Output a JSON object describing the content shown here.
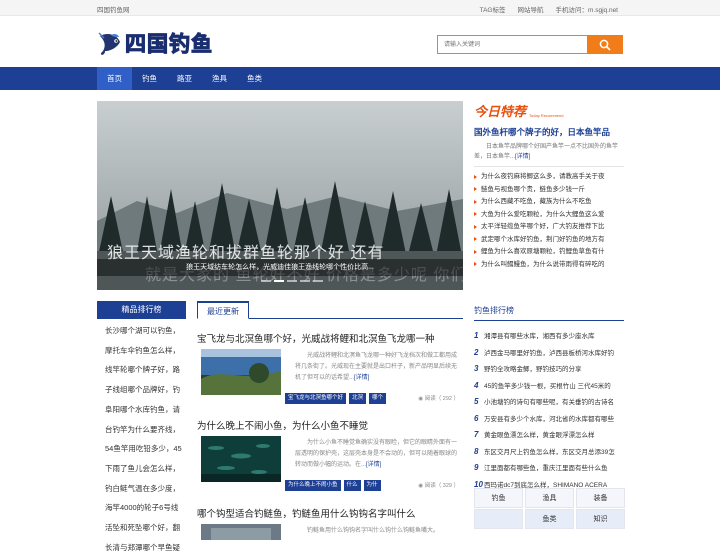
{
  "topbar": {
    "site_name": "四国钓鱼网",
    "links": [
      "TAG标签",
      "网站导航",
      "手机访问：m.sgjq.net"
    ]
  },
  "logo": {
    "text": "四国钓鱼",
    "icon": "fish-logo-icon"
  },
  "search": {
    "placeholder": "请输入关键词",
    "icon": "search-icon"
  },
  "nav": {
    "items": [
      "首页",
      "钓鱼",
      "路亚",
      "渔具",
      "鱼类"
    ],
    "active": 0
  },
  "slider": {
    "big_caption": "狼王天域渔轮和拔群鱼轮那个好 还有",
    "big_caption_2": "就是大家的 鱼轮好不好 价格是多少呢 你们 有钱吗",
    "caption": "狼王天域纺车轮怎么样，光威迪佳狼王渔线轮哪个性价比高...",
    "dots": 5,
    "active_dot": 1
  },
  "today": {
    "badge": "今日特荐",
    "badge_sub": "Today Recommend",
    "headline": "国外鱼杆哪个牌子的好，日本鱼竿品",
    "desc": "日本鱼竿品牌哪个好国产鱼竿一点不比国外的鱼竿差，日本鱼竿...",
    "more": "[详情]",
    "items": [
      "为什么夜钓麻将鲫这么多，请教高手关于夜",
      "鲢鱼与视鱼哪个贵，鲢鱼多少钱一斤",
      "为什么西藏不吃鱼，藏族为什么不吃鱼",
      "大鱼为什么爱吃颗粒，为什么大鲤鱼这么爱",
      "太平洋轻缆鱼竿哪个好，广大钓友推荐下比",
      "武定哪个水库好钓鱼，荆门好钓鱼的地方有",
      "鲤鱼为什么喜欢原塘颗粒，钓鲤鱼草鱼有什",
      "为什么叫鳎鳗鱼，为什么说带雨得有碎吃的"
    ]
  },
  "jingpin": {
    "title": "精品排行榜",
    "items": [
      "长沙哪个湖可以钓鱼，",
      "摩托车伞钓鱼怎么样，",
      "线竿轮哪个牌子好，路",
      "子线组哪个品牌好，钓",
      "阜阳哪个水库钓鱼，请",
      "台钓竿为什么要齐线，",
      "54鱼竿用吃铅多少，45",
      "下雨了鱼儿会怎么样，",
      "钓白鲢气温在多少度，",
      "海竿4000的轮子6号线",
      "活坠和死坠哪个好，翻",
      "长清与郑潭哪个早鱼疑"
    ]
  },
  "latest": {
    "tab": "最近更新",
    "articles": [
      {
        "title": "宝飞龙与北溟鱼哪个好，光威战将鲤和北溟鱼飞龙哪一种",
        "excerpt": "光威战将鲤和北溟鱼飞龙哪一种好飞龙档次和做工都用成将几条街了。光威现在主要就是出口杆子，新产品明显后续无机了但可以的话希望...",
        "more": "[详情]",
        "tags": [
          "宝飞龙与北溟鱼哪个好",
          "北溟",
          "哪个"
        ],
        "reads": "阅读（ 292 ）"
      },
      {
        "title": "为什么晚上不闹小鱼，为什么小鱼不睡觉",
        "excerpt": "为什么小鱼不睡觉鱼确实没有眼睑，但它的眼睛外面有一层透明的保护壳，这层壳本身是不会动的，但可以随着眼球的转动而做小幅的运动。在...",
        "more": "[详情]",
        "tags": [
          "为什么晚上不闹小鱼",
          "什么",
          "为什"
        ],
        "reads": "阅读（ 329 ）"
      },
      {
        "title": "哪个钩型适合钓鲢鱼，钓鲢鱼用什么钩钩名字叫什么",
        "excerpt": "钓鲢鱼用什么钩钩名字叫什么钩什么钩鲢鱼嘴大。"
      }
    ]
  },
  "ranking": {
    "title": "钓鱼排行榜",
    "items": [
      "湘潭县有哪些水库，湘西有多少座水库",
      "泸西金马哪里好钓鱼，泸西县板桥河水库好钓",
      "野钓全攻略金鲫，野钓技巧的分享",
      "45的鱼竿多少钱一根，买根竹山 三代45米的",
      "小池塘钓的诗句有哪些呢，有关垂钓的古诗名",
      "万安县有多少个水库，河北省的水库都有哪些",
      "黄金眼鱼漂怎么样，黄金眼浮漂怎么样",
      "东区交月尺上钓鱼怎么样，东区交月总添39怎",
      "江里面都有哪些鱼，重庆江里面有些什么鱼",
      "西玛诺dc7到底怎么样，SHIMANO ACERA"
    ]
  },
  "categories": [
    "钓鱼",
    "渔具",
    "装备",
    "",
    "鱼类",
    "知识"
  ]
}
